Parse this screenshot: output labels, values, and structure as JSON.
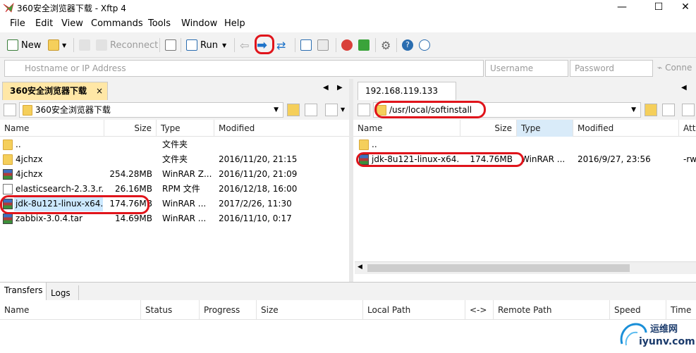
{
  "window": {
    "title": "360安全浏览器下载 - Xftp 4",
    "minimize": "—",
    "maximize": "☐",
    "close": "✕"
  },
  "menu": [
    "File",
    "Edit",
    "View",
    "Commands",
    "Tools",
    "Window",
    "Help"
  ],
  "toolbar": {
    "new_label": "New",
    "reconnect_label": "Reconnect",
    "run_label": "Run"
  },
  "address": {
    "host_placeholder": "Hostname or IP Address",
    "user_placeholder": "Username",
    "pass_placeholder": "Password",
    "connect_label": "Conne"
  },
  "left_pane": {
    "tab": "360安全浏览器下载",
    "tab_close": "×",
    "path": "360安全浏览器下载",
    "columns": [
      "Name",
      "Size",
      "Type",
      "Modified"
    ],
    "rows": [
      {
        "icon": "folder-icon",
        "name": "..",
        "size": "",
        "type": "文件夹",
        "modified": ""
      },
      {
        "icon": "folder-icon",
        "name": "4jchzx",
        "size": "",
        "type": "文件夹",
        "modified": "2016/11/20, 21:15"
      },
      {
        "icon": "rar-icon",
        "name": "4jchzx",
        "size": "254.28MB",
        "type": "WinRAR Z...",
        "modified": "2016/11/20, 21:09"
      },
      {
        "icon": "document-icon",
        "name": "elasticsearch-2.3.3.r...",
        "size": "26.16MB",
        "type": "RPM 文件",
        "modified": "2016/12/18, 16:00"
      },
      {
        "icon": "rar-icon",
        "name": "jdk-8u121-linux-x64...",
        "size": "174.76MB",
        "type": "WinRAR ...",
        "modified": "2017/2/26, 11:30"
      },
      {
        "icon": "rar-icon",
        "name": "zabbix-3.0.4.tar",
        "size": "14.69MB",
        "type": "WinRAR ...",
        "modified": "2016/11/10, 0:17"
      }
    ]
  },
  "right_pane": {
    "tab": "192.168.119.133",
    "path": "/usr/local/softinstall",
    "columns": [
      "Name",
      "Size",
      "Type",
      "Modified",
      "Attr"
    ],
    "rows": [
      {
        "icon": "folder-icon",
        "name": "..",
        "size": "",
        "type": "",
        "modified": "",
        "attr": ""
      },
      {
        "icon": "rar-icon",
        "name": "jdk-8u121-linux-x64...",
        "size": "174.76MB",
        "type": "WinRAR ...",
        "modified": "2016/9/27, 23:56",
        "attr": "-rw"
      }
    ]
  },
  "transfers": {
    "tabs": [
      "Transfers",
      "Logs"
    ],
    "columns": [
      "Name",
      "Status",
      "Progress",
      "Size",
      "Local Path",
      "<->",
      "Remote Path",
      "Speed",
      "Time L"
    ]
  },
  "watermark": {
    "text_top": "运维网",
    "text_bottom": "iyunv.com"
  },
  "colors": {
    "highlight": "#e0141b",
    "selected_row": "#cce8ff",
    "pane_bg": "#f2f2f2"
  }
}
